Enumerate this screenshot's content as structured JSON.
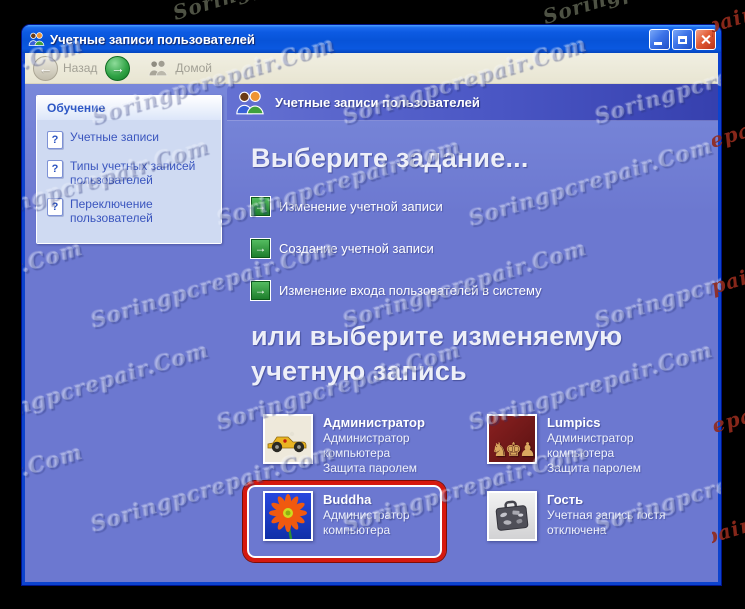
{
  "window": {
    "title": "Учетные записи пользователей"
  },
  "toolbar": {
    "back": "Назад",
    "home": "Домой"
  },
  "sidebar": {
    "title": "Обучение",
    "items": [
      "Учетные записи",
      "Типы учетных записей пользователей",
      "Переключение пользователей"
    ]
  },
  "banner": {
    "title": "Учетные записи пользователей"
  },
  "main": {
    "heading_tasks": "Выберите задание...",
    "tasks": [
      "Изменение учетной записи",
      "Создание учетной записи",
      "Изменение входа пользователей в систему"
    ],
    "heading_accounts": "или выберите изменяемую учетную запись",
    "accounts": [
      {
        "name": "Администратор",
        "line1": "Администратор компьютера",
        "line2": "Защита паролем"
      },
      {
        "name": "Lumpics",
        "line1": "Администратор компьютера",
        "line2": "Защита паролем"
      },
      {
        "name": "Buddha",
        "line1": "Администратор компьютера",
        "line2": ""
      },
      {
        "name": "Гость",
        "line1": "Учетная запись гостя отключена",
        "line2": ""
      }
    ]
  },
  "watermark": {
    "text": "Soringpcrepair.Com"
  },
  "colors": {
    "annotation_red": "#D6190E",
    "titlebar_blue": "#0753D8",
    "content_blue": "#6C78D0",
    "task_green": "#1E7E2C",
    "toolbar_beige": "#ECE9D8"
  }
}
